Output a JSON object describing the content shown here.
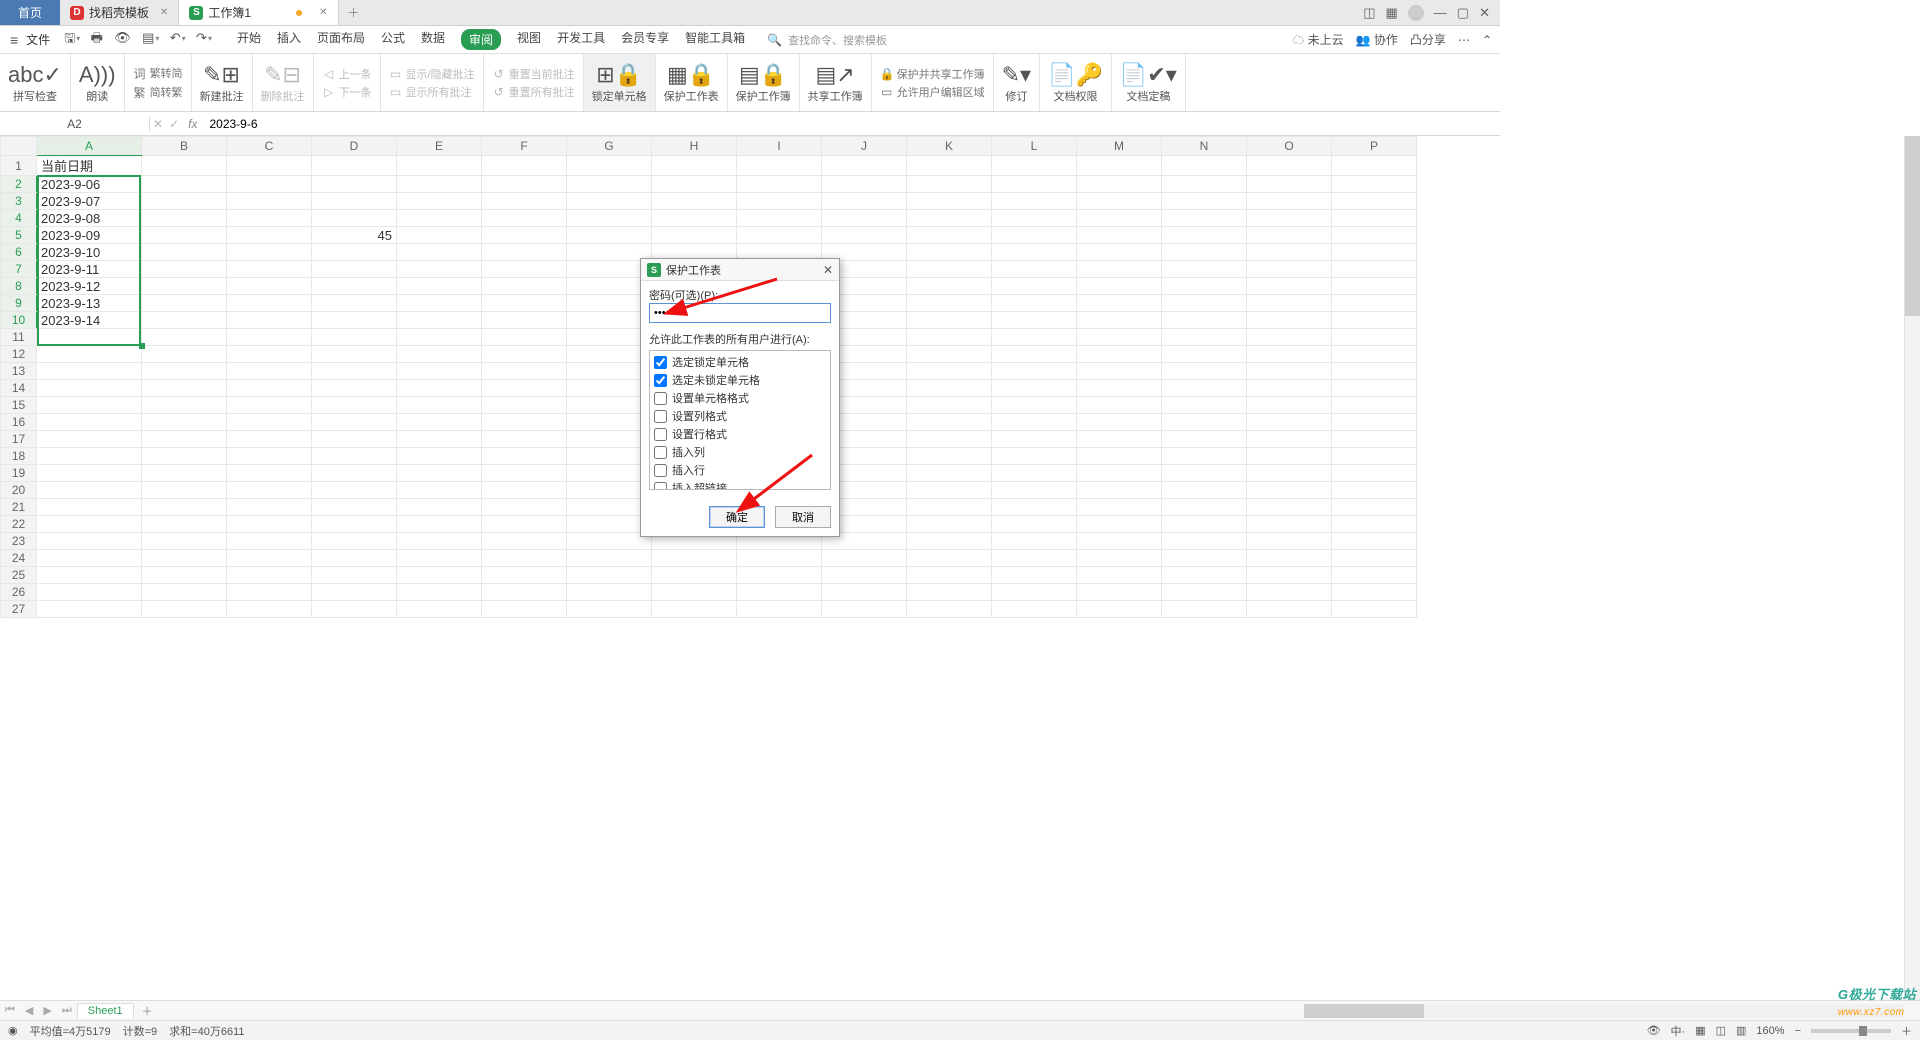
{
  "tabs": {
    "home": "首页",
    "template": "找稻壳模板",
    "workbook": "工作簿1"
  },
  "file_label": "文件",
  "menu": [
    "开始",
    "插入",
    "页面布局",
    "公式",
    "数据",
    "审阅",
    "视图",
    "开发工具",
    "会员专享",
    "智能工具箱"
  ],
  "menu_active": "审阅",
  "search_hint": "查找命令、搜索模板",
  "search_prefix": "Q",
  "topright": {
    "cloud": "未上云",
    "coop": "协作",
    "share": "凸分享"
  },
  "ribbon": {
    "spell": "拼写检查",
    "read": "朗读",
    "s2t_top": "繁转简",
    "s2t_bot": "简转繁",
    "newc": "新建批注",
    "delc": "删除批注",
    "prev": "上一条",
    "next": "下一条",
    "toggle": "显示/隐藏批注",
    "showall": "显示所有批注",
    "resetcur": "重置当前批注",
    "resetall": "重置所有批注",
    "lockcell": "锁定单元格",
    "protect": "保护工作表",
    "protectwb": "保护工作簿",
    "sharewb": "共享工作簿",
    "protshare": "保护并共享工作簿",
    "allowedit": "允许用户编辑区域",
    "track": "修订",
    "docperm": "文档权限",
    "docfix": "文档定稿"
  },
  "namebox": "A2",
  "fxvalue": "2023-9-6",
  "columns": [
    "A",
    "B",
    "C",
    "D",
    "E",
    "F",
    "G",
    "H",
    "I",
    "J",
    "K",
    "L",
    "M",
    "N",
    "O",
    "P"
  ],
  "rowcount": 27,
  "data_colA_header": "当前日期",
  "data_colA": [
    "2023-9-06",
    "2023-9-07",
    "2023-9-08",
    "2023-9-09",
    "2023-9-10",
    "2023-9-11",
    "2023-9-12",
    "2023-9-13",
    "2023-9-14"
  ],
  "cell_D5": "45",
  "dialog": {
    "title": "保护工作表",
    "pwlabel": "密码(可选)(P):",
    "pwvalue": "••••••",
    "listlabel": "允许此工作表的所有用户进行(A):",
    "items": [
      {
        "label": "选定锁定单元格",
        "checked": true
      },
      {
        "label": "选定未锁定单元格",
        "checked": true
      },
      {
        "label": "设置单元格格式",
        "checked": false
      },
      {
        "label": "设置列格式",
        "checked": false
      },
      {
        "label": "设置行格式",
        "checked": false
      },
      {
        "label": "插入列",
        "checked": false
      },
      {
        "label": "插入行",
        "checked": false
      },
      {
        "label": "插入超链接",
        "checked": false
      }
    ],
    "ok": "确定",
    "cancel": "取消"
  },
  "sheettab": "Sheet1",
  "status": {
    "avg": "平均值=4万5179",
    "cnt": "计数=9",
    "sum": "求和=40万6611",
    "zoom": "160%"
  },
  "watermark_a": "极光下载站",
  "watermark_b": "www.xz7.com"
}
